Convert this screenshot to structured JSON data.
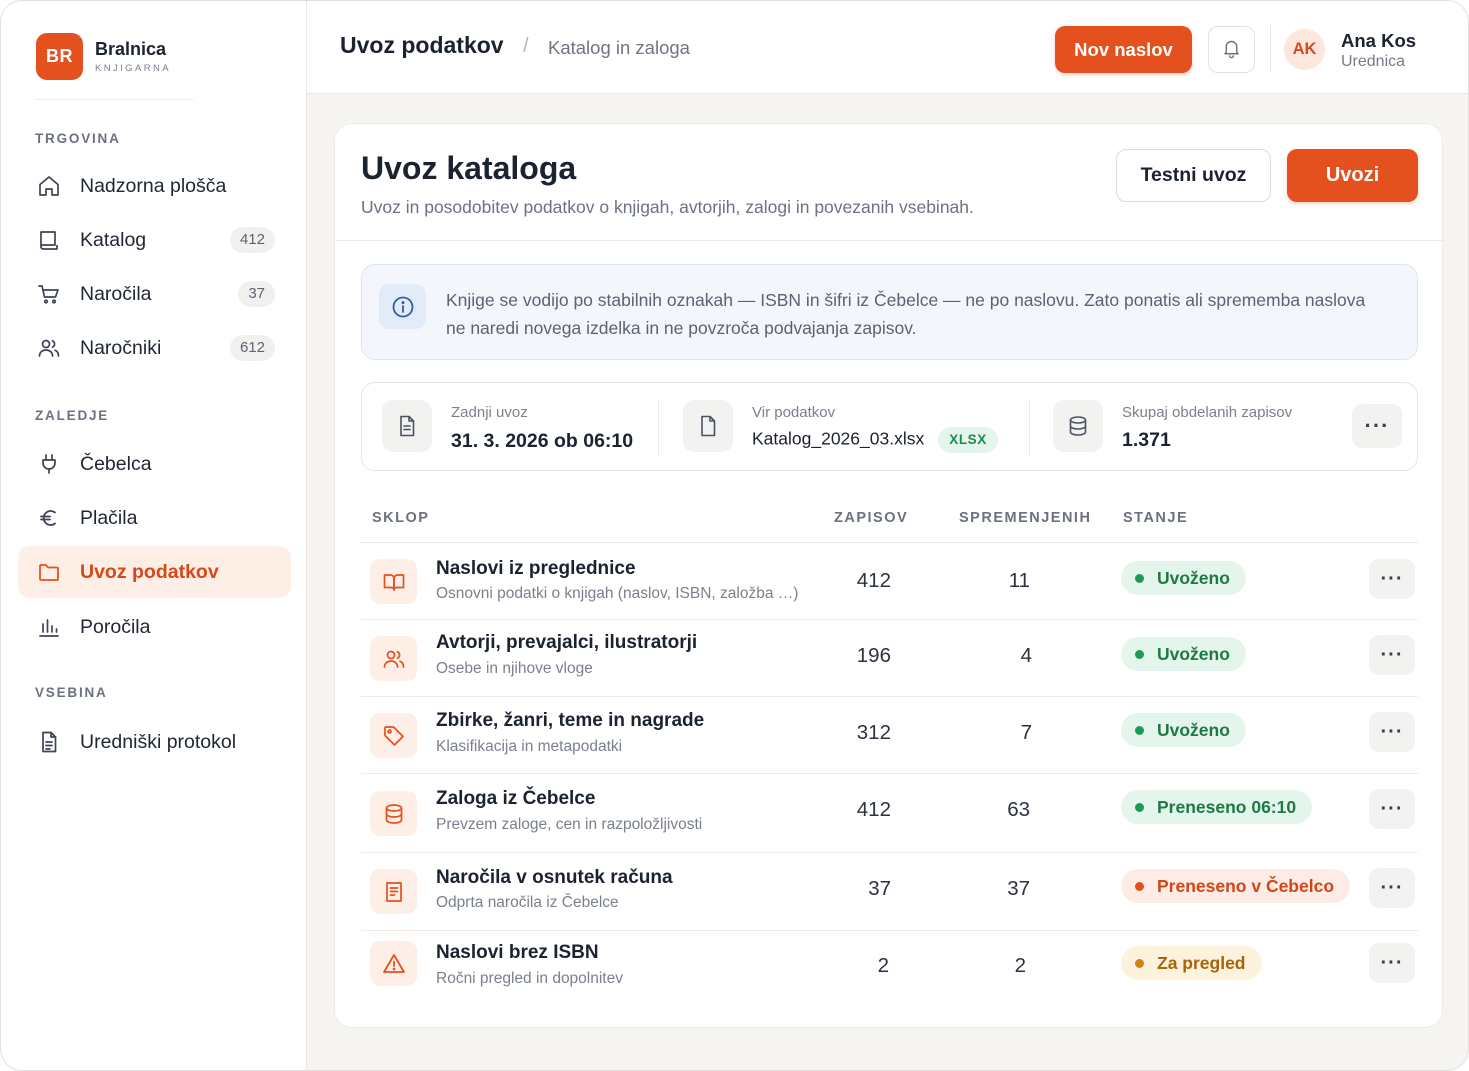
{
  "brand": {
    "logo": "BR",
    "name": "Bralnica",
    "sub": "KNJIGARNA"
  },
  "sidebar": {
    "sections": [
      {
        "title": "TRGOVINA"
      },
      {
        "title": "ZALEDJE"
      },
      {
        "title": "VSEBINA"
      }
    ],
    "items": [
      {
        "label": "Nadzorna plošča",
        "icon": "home-icon",
        "count": ""
      },
      {
        "label": "Katalog",
        "icon": "book-icon",
        "count": "412"
      },
      {
        "label": "Naročila",
        "icon": "cart-icon",
        "count": "37"
      },
      {
        "label": "Naročniki",
        "icon": "users-icon",
        "count": "612"
      },
      {
        "label": "Čebelca",
        "icon": "plug-icon",
        "count": ""
      },
      {
        "label": "Plačila",
        "icon": "euro-icon",
        "count": ""
      },
      {
        "label": "Uvoz podatkov",
        "icon": "folder-icon",
        "count": "",
        "active": true
      },
      {
        "label": "Poročila",
        "icon": "bar-chart-icon",
        "count": ""
      },
      {
        "label": "Uredniški protokol",
        "icon": "document-icon",
        "count": ""
      }
    ]
  },
  "header": {
    "title": "Uvoz podatkov",
    "separator": "/",
    "breadcrumb": "Katalog in zaloga",
    "new_button": "Nov naslov",
    "user": {
      "initials": "AK",
      "name": "Ana Kos",
      "role": "Urednica"
    }
  },
  "main": {
    "title": "Uvoz kataloga",
    "subtitle": "Uvoz in posodobitev podatkov o knjigah, avtorjih, zalogi in povezanih vsebinah.",
    "test_button": "Testni uvoz",
    "import_button": "Uvozi",
    "info": "Knjige se vodijo po stabilnih oznakah — ISBN in šifri iz Čebelce — ne po naslovu. Zato ponatis ali sprememba naslova ne naredi novega izdelka in ne povzroča podvajanja zapisov.",
    "meta": {
      "last_import_label": "Zadnji uvoz",
      "last_import_value": "31. 3. 2026 ob 06:10",
      "source_label": "Vir podatkov",
      "source_value": "Katalog_2026_03.xlsx",
      "source_badge": "XLSX",
      "total_label": "Skupaj obdelanih zapisov",
      "total_value": "1.371",
      "more": "···"
    },
    "table": {
      "headers": {
        "set": "SKLOP",
        "records": "ZAPISOV",
        "changed": "SPREMENJENIH",
        "status": "STANJE"
      },
      "rows": [
        {
          "icon": "open-book-icon",
          "title": "Naslovi iz preglednice",
          "desc": "Osnovni podatki o knjigah (naslov, ISBN, založba …)",
          "records": "412",
          "changed": "11",
          "status": "Uvoženo",
          "status_type": "ok"
        },
        {
          "icon": "users-icon",
          "title": "Avtorji, prevajalci, ilustratorji",
          "desc": "Osebe in njihove vloge",
          "records": "196",
          "changed": "4",
          "status": "Uvoženo",
          "status_type": "ok"
        },
        {
          "icon": "tag-icon",
          "title": "Zbirke, žanri, teme in nagrade",
          "desc": "Klasifikacija in metapodatki",
          "records": "312",
          "changed": "7",
          "status": "Uvoženo",
          "status_type": "ok"
        },
        {
          "icon": "database-icon",
          "title": "Zaloga iz Čebelce",
          "desc": "Prevzem zaloge, cen in razpoložljivosti",
          "records": "412",
          "changed": "63",
          "status": "Preneseno 06:10",
          "status_type": "ok"
        },
        {
          "icon": "receipt-icon",
          "title": "Naročila v osnutek računa",
          "desc": "Odprta naročila iz Čebelce",
          "records": "37",
          "changed": "37",
          "status": "Preneseno v Čebelco",
          "status_type": "err"
        },
        {
          "icon": "warning-icon",
          "title": "Naslovi brez ISBN",
          "desc": "Ročni pregled in dopolnitev",
          "records": "2",
          "changed": "2",
          "status": "Za pregled",
          "status_type": "warn"
        }
      ],
      "row_more": "···"
    }
  }
}
